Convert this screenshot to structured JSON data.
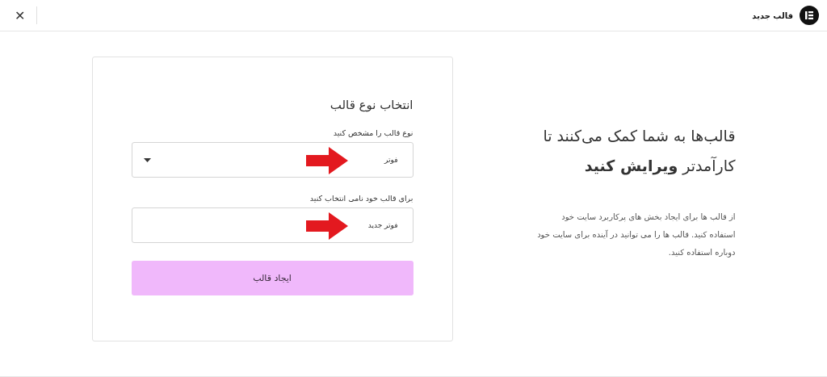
{
  "header": {
    "title": "قالب جدید",
    "close": "✕"
  },
  "intro": {
    "headline": "قالب‌ها به شما کمک می‌کنند تا کارآمدتر **ویرایش کنید**",
    "description": "از قالب ها برای ایجاد بخش های پرکاربرد سایت خود استفاده کنید. قالب ها را می توانید در آینده برای سایت خود دوباره استفاده کنید."
  },
  "form": {
    "title": "انتخاب نوع قالب",
    "fields": [
      {
        "kind": "select",
        "label": "نوع قالب را مشخص کنید",
        "value": "فوتر",
        "annotated": true
      },
      {
        "kind": "text",
        "label": "برای قالب خود نامی انتخاب کنید",
        "value": "فوتر جدید",
        "annotated": true
      }
    ],
    "submit": "ایجاد قالب"
  }
}
